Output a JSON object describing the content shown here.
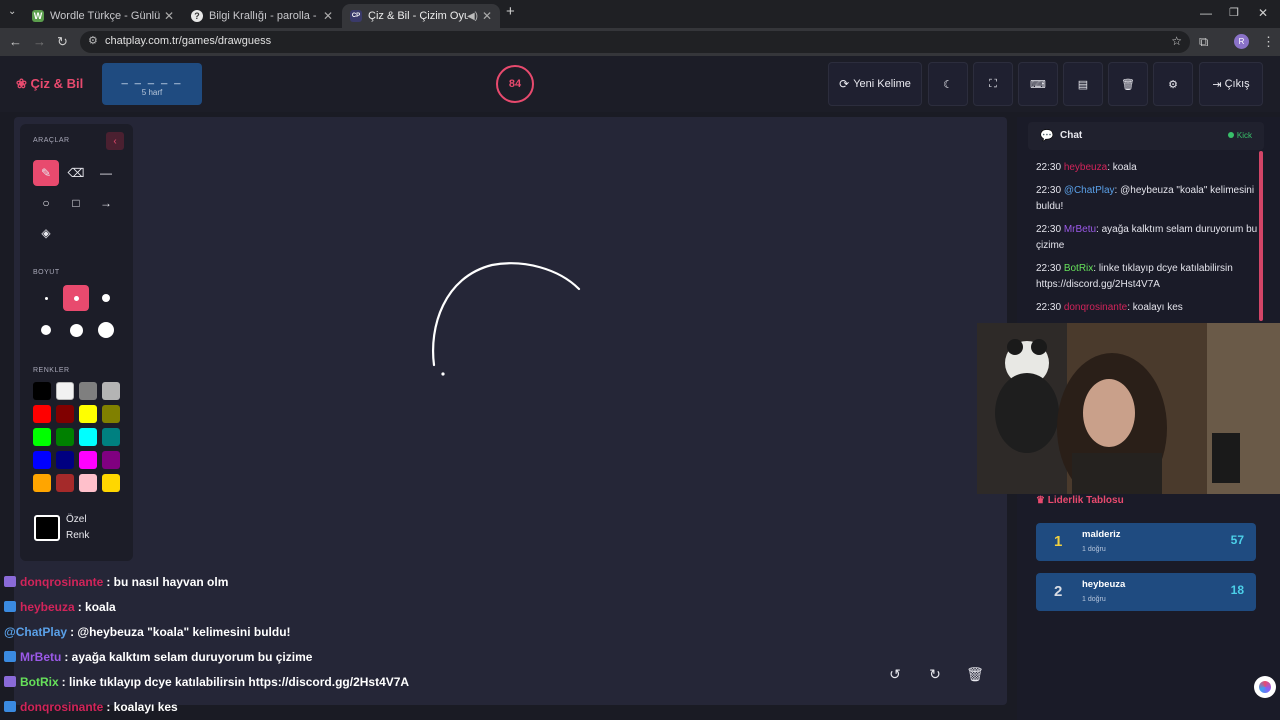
{
  "browser": {
    "tabs": [
      {
        "title": "Wordle Türkçe - Günlük Kelime",
        "favicon": "W"
      },
      {
        "title": "Bilgi Krallığı - parolla - Kelime",
        "favicon": "?"
      },
      {
        "title": "Çiz & Bil - Çizim Oyunu",
        "favicon": "CP"
      }
    ],
    "url": "chatplay.com.tr/games/drawguess",
    "profile": "R"
  },
  "game": {
    "logo": "Çiz & Bil",
    "word_mask": "_ _ _ _ _",
    "word_length": "5 harf",
    "timer": "84",
    "new_word_label": "Yeni Kelime",
    "exit_label": "Çıkış"
  },
  "tools": {
    "tools_label": "ARAÇLAR",
    "size_label": "BOYUT",
    "colors_label": "RENKLER",
    "custom_color_line1": "Özel",
    "custom_color_line2": "Renk",
    "palette": [
      "#000000",
      "#f2f2f2",
      "#7f7f7f",
      "#b4b4b4",
      "#ff0000",
      "#800000",
      "#ffff00",
      "#808000",
      "#00ff00",
      "#008000",
      "#00ffff",
      "#008080",
      "#0000ff",
      "#000080",
      "#ff00ff",
      "#800080",
      "#ffa500",
      "#a52a2a",
      "#ffc0cb",
      "#ffd700"
    ]
  },
  "overlay_chat": [
    {
      "user": "donqrosinante",
      "color": "#d1245a",
      "msg": ": bu nasıl hayvan olm"
    },
    {
      "user": "heybeuza",
      "color": "#d1245a",
      "msg": ": koala"
    },
    {
      "user": "@ChatPlay",
      "color": "#5aa0e8",
      "msg": ": @heybeuza \"koala\" kelimesini buldu!"
    },
    {
      "user": "MrBetu",
      "color": "#9b59e8",
      "msg": ": ayağa kalktım selam duruyorum bu çizime"
    },
    {
      "user": "BotRix",
      "color": "#66e05a",
      "msg": ": linke tıklayıp dcye katılabilirsin https://discord.gg/2Hst4V7A"
    },
    {
      "user": "donqrosinante",
      "color": "#d1245a",
      "msg": ": koalayı kes"
    }
  ],
  "chat": {
    "title": "Chat",
    "status": "Kick",
    "messages": [
      {
        "time": "22:30",
        "user": "heybeuza",
        "color": "#d1245a",
        "msg": ": koala"
      },
      {
        "time": "22:30",
        "user": "@ChatPlay",
        "color": "#5aa0e8",
        "msg": ": @heybeuza \"koala\" kelimesini buldu!"
      },
      {
        "time": "22:30",
        "user": "MrBetu",
        "color": "#9b59e8",
        "msg": ": ayağa kalktım selam duruyorum bu çizime"
      },
      {
        "time": "22:30",
        "user": "BotRix",
        "color": "#66e05a",
        "msg": ": linke tıklayıp dcye katılabilirsin https://discord.gg/2Hst4V7A"
      },
      {
        "time": "22:30",
        "user": "donqrosinante",
        "color": "#d1245a",
        "msg": ": koalayı kes"
      }
    ]
  },
  "leaderboard": {
    "title": "Liderlik Tablosu",
    "rows": [
      {
        "rank": "1",
        "rank_color": "#f0d040",
        "name": "malderiz",
        "sub": "1 doğru",
        "score": "57"
      },
      {
        "rank": "2",
        "rank_color": "#d8dce4",
        "name": "heybeuza",
        "sub": "1 doğru",
        "score": "18"
      }
    ]
  }
}
